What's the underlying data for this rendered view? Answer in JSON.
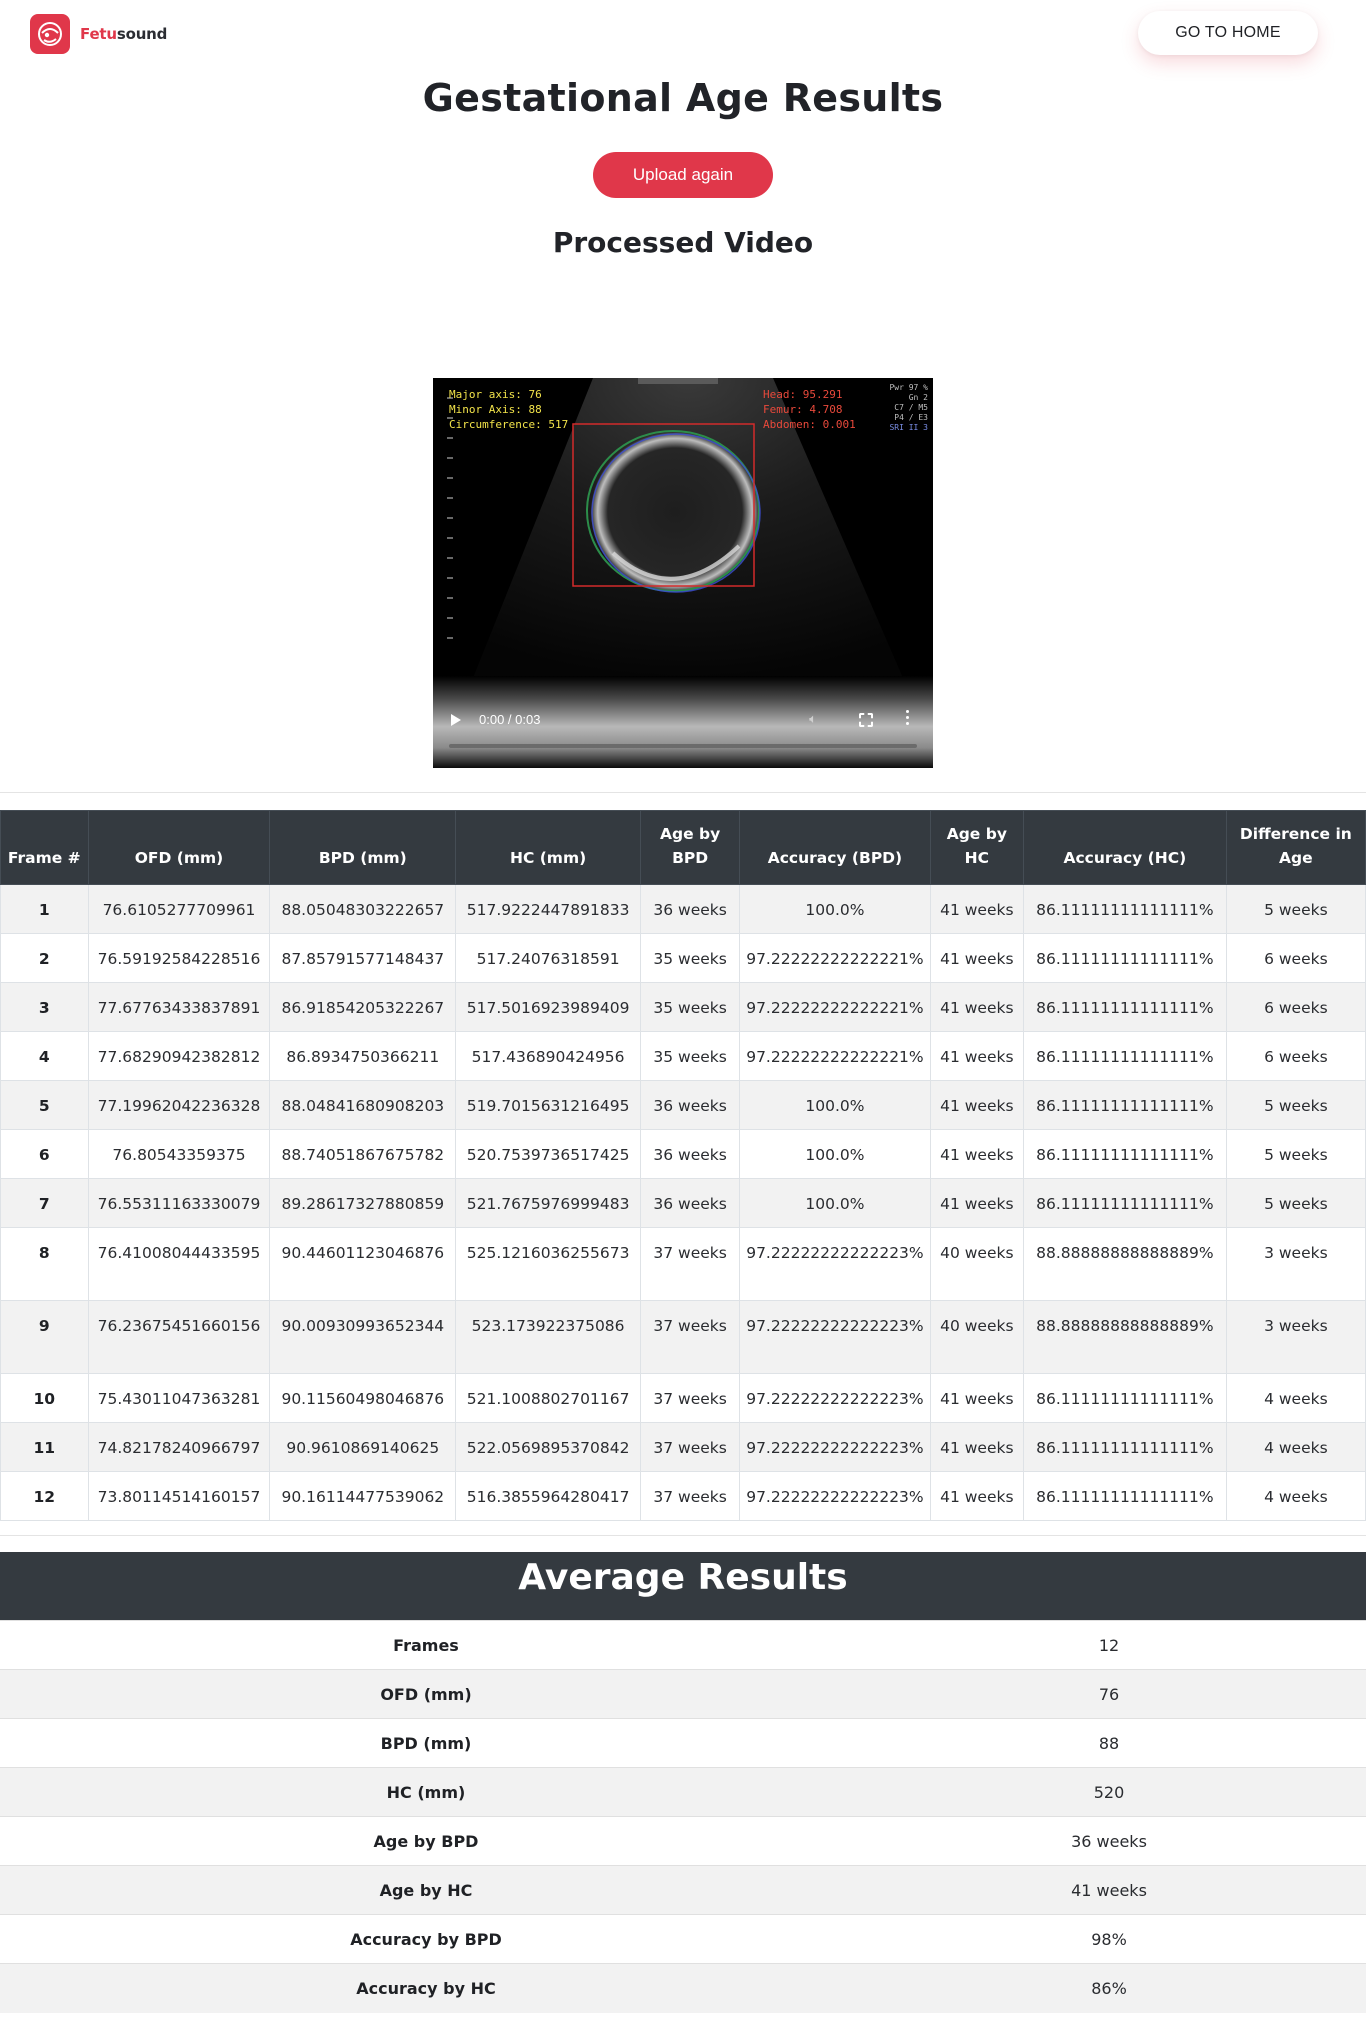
{
  "brand": {
    "name_red": "Fetu",
    "name_dark": "sound"
  },
  "header": {
    "home_label": "GO TO HOME"
  },
  "page": {
    "title": "Gestational Age Results",
    "upload_label": "Upload again",
    "video_heading": "Processed Video"
  },
  "video": {
    "overlay_left": [
      "Major axis: 76",
      "Minor Axis: 88",
      "Circumference: 517"
    ],
    "overlay_right": [
      "Head: 95.291",
      "Femur: 4.708",
      "Abdomen: 0.001"
    ],
    "overlay_corner": [
      "Pwr 97 %",
      "Gn  2",
      "C7 / M5",
      "P4 / E3",
      "SRI II 3"
    ],
    "time": "0:00 / 0:03",
    "progress": 0
  },
  "frames_table": {
    "headers": [
      "Frame #",
      "OFD (mm)",
      "BPD (mm)",
      "HC (mm)",
      "Age by BPD",
      "Accuracy (BPD)",
      "Age by HC",
      "Accuracy (HC)",
      "Difference in Age"
    ],
    "rows": [
      [
        "1",
        "76.6105277709961",
        "88.05048303222657",
        "517.9222447891833",
        "36 weeks",
        "100.0%",
        "41 weeks",
        "86.11111111111111%",
        "5 weeks"
      ],
      [
        "2",
        "76.59192584228516",
        "87.85791577148437",
        "517.24076318591",
        "35 weeks",
        "97.22222222222221%",
        "41 weeks",
        "86.11111111111111%",
        "6 weeks"
      ],
      [
        "3",
        "77.67763433837891",
        "86.91854205322267",
        "517.5016923989409",
        "35 weeks",
        "97.22222222222221%",
        "41 weeks",
        "86.11111111111111%",
        "6 weeks"
      ],
      [
        "4",
        "77.68290942382812",
        "86.8934750366211",
        "517.436890424956",
        "35 weeks",
        "97.22222222222221%",
        "41 weeks",
        "86.11111111111111%",
        "6 weeks"
      ],
      [
        "5",
        "77.19962042236328",
        "88.04841680908203",
        "519.7015631216495",
        "36 weeks",
        "100.0%",
        "41 weeks",
        "86.11111111111111%",
        "5 weeks"
      ],
      [
        "6",
        "76.80543359375",
        "88.74051867675782",
        "520.7539736517425",
        "36 weeks",
        "100.0%",
        "41 weeks",
        "86.11111111111111%",
        "5 weeks"
      ],
      [
        "7",
        "76.55311163330079",
        "89.28617327880859",
        "521.7675976999483",
        "36 weeks",
        "100.0%",
        "41 weeks",
        "86.11111111111111%",
        "5 weeks"
      ],
      [
        "8",
        "76.41008044433595",
        "90.44601123046876",
        "525.1216036255673",
        "37 weeks",
        "97.22222222222223%",
        "40 weeks",
        "88.88888888888889%",
        "3 weeks"
      ],
      [
        "9",
        "76.23675451660156",
        "90.00930993652344",
        "523.173922375086",
        "37 weeks",
        "97.22222222222223%",
        "40 weeks",
        "88.88888888888889%",
        "3 weeks"
      ],
      [
        "10",
        "75.43011047363281",
        "90.11560498046876",
        "521.1008802701167",
        "37 weeks",
        "97.22222222222223%",
        "41 weeks",
        "86.11111111111111%",
        "4 weeks"
      ],
      [
        "11",
        "74.82178240966797",
        "90.9610869140625",
        "522.0569895370842",
        "37 weeks",
        "97.22222222222223%",
        "41 weeks",
        "86.11111111111111%",
        "4 weeks"
      ],
      [
        "12",
        "73.80114514160157",
        "90.16114477539062",
        "516.3855964280417",
        "37 weeks",
        "97.22222222222223%",
        "41 weeks",
        "86.11111111111111%",
        "4 weeks"
      ]
    ]
  },
  "averages": {
    "title": "Average Results",
    "rows": [
      [
        "Frames",
        "12"
      ],
      [
        "OFD (mm)",
        "76"
      ],
      [
        "BPD (mm)",
        "88"
      ],
      [
        "HC (mm)",
        "520"
      ],
      [
        "Age by BPD",
        "36 weeks"
      ],
      [
        "Age by HC",
        "41 weeks"
      ],
      [
        "Accuracy by BPD",
        "98%"
      ],
      [
        "Accuracy by HC",
        "86%"
      ]
    ]
  },
  "colors": {
    "accent": "#e0374a",
    "table_header": "#343a40",
    "stripe": "#f2f2f2"
  }
}
